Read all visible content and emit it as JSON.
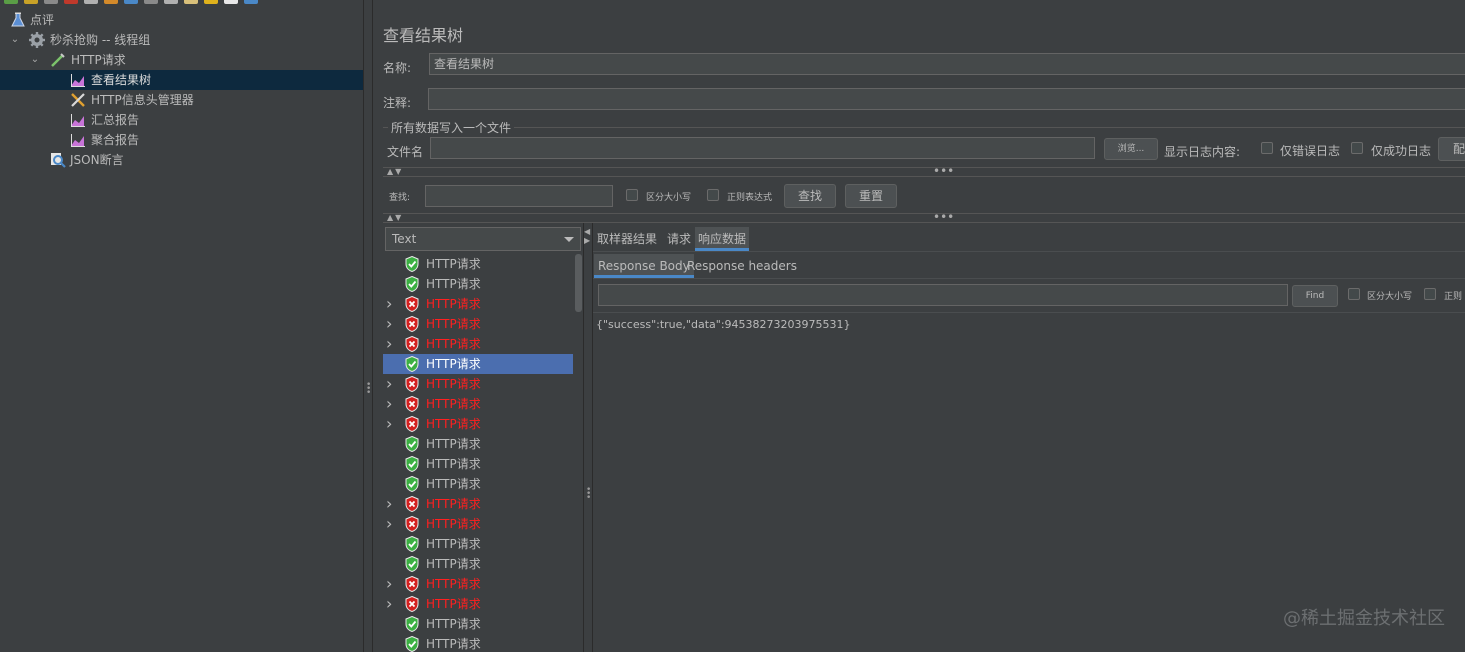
{
  "toolbar": {
    "colors": [
      "#5a9e46",
      "#c9a227",
      "#8a8a8a",
      "#c0392b",
      "#b0b0b0",
      "#d48a2a",
      "#4a88c7",
      "#8a8a8a",
      "#b0b0b0",
      "#d9c07a",
      "#e0b21c",
      "#e8e8e8",
      "#4a88c7"
    ]
  },
  "tree": {
    "items": [
      {
        "label": "点评",
        "icon": "flask-icon"
      },
      {
        "label": "秒杀抢购 -- 线程组",
        "icon": "gear-icon"
      },
      {
        "label": "HTTP请求",
        "icon": "pipette-icon"
      },
      {
        "label": "查看结果树",
        "icon": "chart-icon"
      },
      {
        "label": "HTTP信息头管理器",
        "icon": "tools-icon"
      },
      {
        "label": "汇总报告",
        "icon": "chart-icon"
      },
      {
        "label": "聚合报告",
        "icon": "chart-icon"
      },
      {
        "label": "JSON断言",
        "icon": "magnifier-icon"
      }
    ]
  },
  "panel": {
    "title": "查看结果树",
    "name_label": "名称:",
    "name_value": "查看结果树",
    "comment_label": "注释:",
    "comment_value": "",
    "file_group_title": "所有数据写入一个文件",
    "filename_label": "文件名",
    "filename_value": "",
    "browse_label": "浏览...",
    "log_label": "显示日志内容:",
    "errors_only_label": "仅错误日志",
    "success_only_label": "仅成功日志",
    "config_label": "配",
    "search_label": "查找:",
    "search_value": "",
    "case_label": "区分大小写",
    "regex_label": "正则表达式",
    "find_label": "查找",
    "reset_label": "重置"
  },
  "results": {
    "renderer": "Text",
    "items": [
      {
        "label": "HTTP请求",
        "status": "ok"
      },
      {
        "label": "HTTP请求",
        "status": "ok"
      },
      {
        "label": "HTTP请求",
        "status": "error"
      },
      {
        "label": "HTTP请求",
        "status": "error"
      },
      {
        "label": "HTTP请求",
        "status": "error"
      },
      {
        "label": "HTTP请求",
        "status": "ok",
        "selected": true
      },
      {
        "label": "HTTP请求",
        "status": "error"
      },
      {
        "label": "HTTP请求",
        "status": "error"
      },
      {
        "label": "HTTP请求",
        "status": "error"
      },
      {
        "label": "HTTP请求",
        "status": "ok"
      },
      {
        "label": "HTTP请求",
        "status": "ok"
      },
      {
        "label": "HTTP请求",
        "status": "ok"
      },
      {
        "label": "HTTP请求",
        "status": "error"
      },
      {
        "label": "HTTP请求",
        "status": "error"
      },
      {
        "label": "HTTP请求",
        "status": "ok"
      },
      {
        "label": "HTTP请求",
        "status": "ok"
      },
      {
        "label": "HTTP请求",
        "status": "error"
      },
      {
        "label": "HTTP请求",
        "status": "error"
      },
      {
        "label": "HTTP请求",
        "status": "ok"
      },
      {
        "label": "HTTP请求",
        "status": "ok"
      }
    ]
  },
  "detail": {
    "tabs": [
      "取样器结果",
      "请求",
      "响应数据"
    ],
    "active_tab": "响应数据",
    "subtabs": [
      "Response Body",
      "Response headers"
    ],
    "active_subtab": "Response Body",
    "search_value": "",
    "find_label": "Find",
    "case_label": "区分大小写",
    "regex_label": "正则",
    "response_body": "{\"success\":true,\"data\":94538273203975531}"
  },
  "watermark": "@稀土掘金技术社区",
  "colors": {
    "background": "#3c3f41",
    "selection": "#4b6eaf",
    "success": "#3cb043",
    "error": "#d42020",
    "error_text": "#ff2020"
  }
}
